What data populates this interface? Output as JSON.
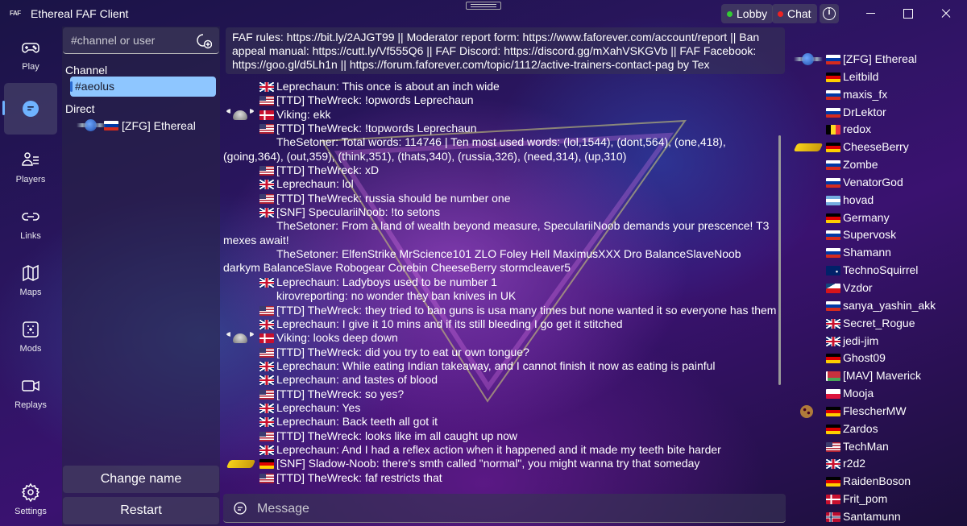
{
  "window": {
    "logo": "FAF",
    "title": "Ethereal FAF Client",
    "lobby_label": "Lobby",
    "chat_label": "Chat",
    "info_glyph": "i",
    "lobby_status_color": "#33cc33",
    "chat_status_color": "#ee2222"
  },
  "nav": {
    "items": [
      {
        "label": "Play",
        "icon": "gamepad-icon"
      },
      {
        "label": "",
        "icon": "chat-icon",
        "active": true
      },
      {
        "label": "Players",
        "icon": "players-icon"
      },
      {
        "label": "Links",
        "icon": "link-icon"
      },
      {
        "label": "Maps",
        "icon": "map-icon"
      },
      {
        "label": "Mods",
        "icon": "mods-icon"
      },
      {
        "label": "Replays",
        "icon": "video-icon"
      },
      {
        "label": "Settings",
        "icon": "gear-icon"
      }
    ]
  },
  "channels": {
    "search_placeholder": "#channel or user",
    "channel_header": "Channel",
    "active_channel": "#aeolus",
    "direct_header": "Direct",
    "direct_user": "[ZFG] Ethereal",
    "change_name": "Change name",
    "restart": "Restart"
  },
  "topic": "FAF rules: https://bit.ly/2AJGT99 || Moderator report form: https://www.faforever.com/account/report || Ban appeal manual: https://cutt.ly/Vf555Q6 || FAF Discord: https://discord.gg/mXahVSKGVb || FAF Facebook: https://goo.gl/d5Lh1n || https://forum.faforever.com/topic/1112/active-trainers-contact-pag by Tex",
  "messages": [
    {
      "flag": "gb",
      "text": "Leprechaun: This once is about an inch wide"
    },
    {
      "flag": "us",
      "text": "[TTD] TheWreck: !opwords Leprechaun"
    },
    {
      "flag": "dk",
      "avatar": "viking",
      "text": "Viking: ekk"
    },
    {
      "flag": "us",
      "text": "[TTD] TheWreck: !topwords Leprechaun"
    },
    {
      "flag": "",
      "wrap": true,
      "text": "TheSetoner: Total words: 114746 | Ten most used words: (lol,1544), (dont,564), (one,418), (going,364), (out,359), (think,351), (thats,340), (russia,326), (need,314), (up,310)"
    },
    {
      "flag": "us",
      "text": "[TTD] TheWreck: xD"
    },
    {
      "flag": "gb",
      "text": "Leprechaun: lol"
    },
    {
      "flag": "us",
      "text": "[TTD] TheWreck: russia should be number one"
    },
    {
      "flag": "gb",
      "text": "[SNF] SpeculariiNoob: !to setons"
    },
    {
      "flag": "",
      "wrap": true,
      "text": "TheSetoner: From a land of wealth beyond measure, SpeculariiNoob demands your prescence! T3 mexes await!"
    },
    {
      "flag": "",
      "wrap": true,
      "text": "TheSetoner: ElfenStrike MrScience101 ZLO Foley Hell MaximusXXX Dro BalanceSlaveNoob darkym BalanceSlave Robogear Corebin CheeseBerry stormcleaver5"
    },
    {
      "flag": "gb",
      "text": "Leprechaun: Ladyboys used to be number 1"
    },
    {
      "flag": "",
      "text": "kirovreporting: no wonder they ban knives in UK"
    },
    {
      "flag": "us",
      "text": "[TTD] TheWreck: they tried to ban guns is usa many times but none wanted it so everyone has them"
    },
    {
      "flag": "gb",
      "text": "Leprechaun: I give it 10 mins and if its still bleeding I go get it stitched"
    },
    {
      "flag": "dk",
      "avatar": "viking",
      "text": "Viking: looks deep down"
    },
    {
      "flag": "us",
      "text": "[TTD] TheWreck: did you try to eat ur own tongue?"
    },
    {
      "flag": "gb",
      "text": "Leprechaun: While eating Indian takeaway, and I cannot finish it now as eating is painful"
    },
    {
      "flag": "gb",
      "text": "Leprechaun: and tastes of blood"
    },
    {
      "flag": "us",
      "text": "[TTD] TheWreck: so yes?"
    },
    {
      "flag": "gb",
      "text": "Leprechaun: Yes"
    },
    {
      "flag": "gb",
      "text": "Leprechaun: Back teeth all got it"
    },
    {
      "flag": "us",
      "text": "[TTD] TheWreck: looks like im all caught up now"
    },
    {
      "flag": "gb",
      "text": "Leprechaun: And I had a reflex action when it happened and it made my teeth bite harder"
    },
    {
      "flag": "de",
      "avatar": "gold",
      "text": "[SNF] Sladow-Noob: there's smth called \"normal\", you might wanna try that someday"
    },
    {
      "flag": "us",
      "text": "[TTD] TheWreck: faf restricts that"
    }
  ],
  "message_placeholder": "Message",
  "users": [
    {
      "name": "[ZFG] Ethereal",
      "flag": "ru",
      "avatar": "globe"
    },
    {
      "name": "Leitbild",
      "flag": "de"
    },
    {
      "name": "maxis_fx",
      "flag": "ru"
    },
    {
      "name": "DrLektor",
      "flag": "ru"
    },
    {
      "name": "redox",
      "flag": "be"
    },
    {
      "name": "CheeseBerry",
      "flag": "de",
      "avatar": "gold"
    },
    {
      "name": "Zombe",
      "flag": "ru"
    },
    {
      "name": "VenatorGod",
      "flag": "ru"
    },
    {
      "name": "hovad",
      "flag": "ar"
    },
    {
      "name": "Germany",
      "flag": "de"
    },
    {
      "name": "Supervosk",
      "flag": "ru"
    },
    {
      "name": "Shamann",
      "flag": "ru"
    },
    {
      "name": "TechnoSquirrel",
      "flag": "au"
    },
    {
      "name": "Vzdor",
      "flag": "cz"
    },
    {
      "name": "sanya_yashin_akk",
      "flag": "ru"
    },
    {
      "name": "Secret_Rogue",
      "flag": "gb"
    },
    {
      "name": "jedi-jim",
      "flag": "gb"
    },
    {
      "name": "Ghost09",
      "flag": "de"
    },
    {
      "name": "[MAV] Maverick",
      "flag": "by"
    },
    {
      "name": "Mooja",
      "flag": "pl"
    },
    {
      "name": "FlescherMW",
      "flag": "de",
      "avatar": "cookie"
    },
    {
      "name": "Zardos",
      "flag": "de"
    },
    {
      "name": "TechMan",
      "flag": "us"
    },
    {
      "name": "r2d2",
      "flag": "gb"
    },
    {
      "name": "RaidenBoson",
      "flag": "de"
    },
    {
      "name": "Frit_pom",
      "flag": "dk"
    },
    {
      "name": "Santamunn",
      "flag": "no"
    }
  ]
}
